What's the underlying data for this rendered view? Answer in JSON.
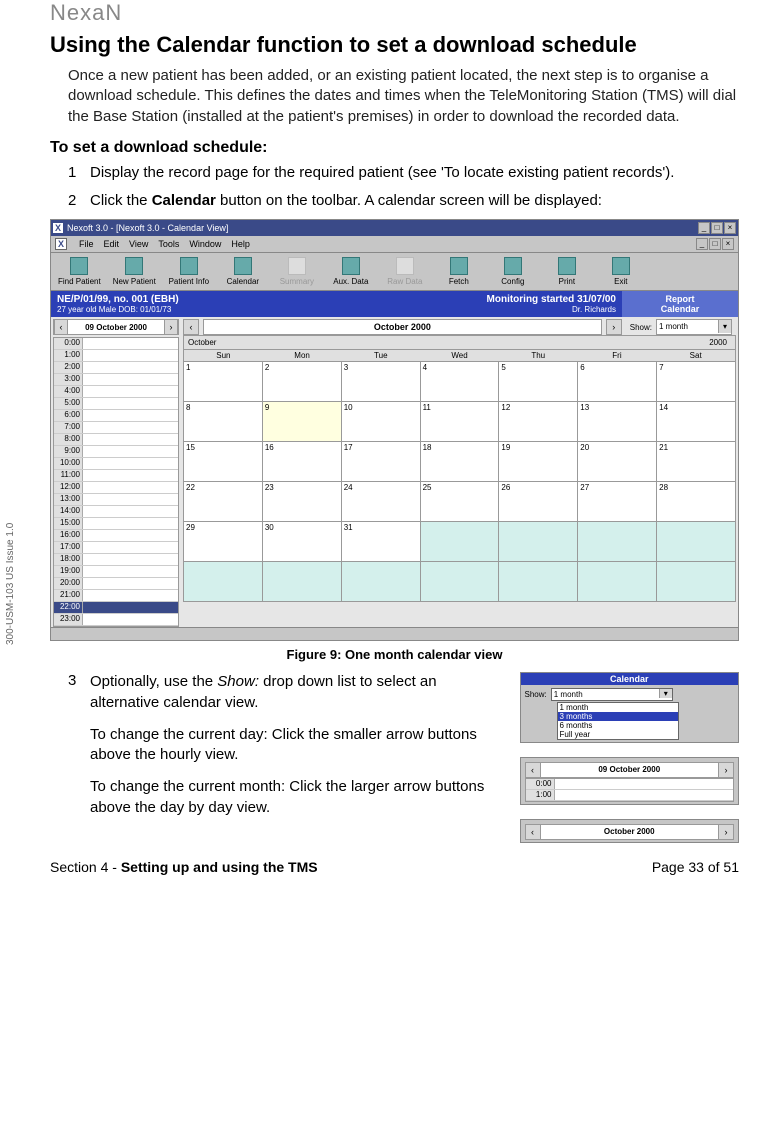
{
  "brand": "NexaN",
  "heading": "Using the Calendar function to set a download schedule",
  "intro_body": "Once a new patient has been added, or an existing patient located, the next step is to organise a download schedule. This defines the dates and times when the TeleMonitoring Station (TMS) will dial the Base Station (installed at the patient's premises) in order to download the recorded data.",
  "subheading": "To set a download schedule:",
  "step1_num": "1",
  "step1_body": "Display the record page for the required patient (see 'To locate existing patient records').",
  "step2_num": "2",
  "step2_pre": "Click the ",
  "step2_bold": "Calendar",
  "step2_post": " button on the toolbar. A calendar screen will be displayed:",
  "ss": {
    "outer_title": "Nexoft 3.0 - [Nexoft 3.0 - Calendar View]",
    "menu": {
      "file": "File",
      "edit": "Edit",
      "view": "View",
      "tools": "Tools",
      "window": "Window",
      "help": "Help"
    },
    "toolbar": {
      "find": "Find Patient",
      "new": "New Patient",
      "info": "Patient Info",
      "calendar": "Calendar",
      "summary": "Summary",
      "aux": "Aux. Data",
      "raw": "Raw Data",
      "fetch": "Fetch",
      "config": "Config",
      "print": "Print",
      "exit": "Exit"
    },
    "patient": {
      "title": "NE/P/01/99, no. 001 (EBH)",
      "sub": "27 year old Male  DOB: 01/01/73",
      "mon_started": "Monitoring started 31/07/00",
      "mon_sub": "Dr. Richards",
      "report": "Report",
      "calendar": "Calendar"
    },
    "date_nav_label": "09 October 2000",
    "hours": [
      "0:00",
      "1:00",
      "2:00",
      "3:00",
      "4:00",
      "5:00",
      "6:00",
      "7:00",
      "8:00",
      "9:00",
      "10:00",
      "11:00",
      "12:00",
      "13:00",
      "14:00",
      "15:00",
      "16:00",
      "17:00",
      "18:00",
      "19:00",
      "20:00",
      "21:00",
      "22:00",
      "23:00"
    ],
    "selected_hour_index": 22,
    "month_nav_label": "October 2000",
    "show_label": "Show:",
    "show_value": "1 month",
    "month_header_month": "October",
    "month_header_year": "2000",
    "dow": [
      "Sun",
      "Mon",
      "Tue",
      "Wed",
      "Thu",
      "Fri",
      "Sat"
    ],
    "cells": [
      "1",
      "2",
      "3",
      "4",
      "5",
      "6",
      "7",
      "8",
      "9",
      "10",
      "11",
      "12",
      "13",
      "14",
      "15",
      "16",
      "17",
      "18",
      "19",
      "20",
      "21",
      "22",
      "23",
      "24",
      "25",
      "26",
      "27",
      "28",
      "29",
      "30",
      "31",
      "",
      "",
      "",
      "",
      "",
      "",
      "",
      "",
      "",
      "",
      ""
    ],
    "today_index": 8,
    "next_start_index": 31
  },
  "figure_caption": "Figure 9: One month calendar view",
  "step3_num": "3",
  "step3_a1": "Optionally, use the ",
  "step3_a_italic": "Show:",
  "step3_a2": " drop down list to select an alternative calendar view.",
  "step3_b": "To change the current day: Click the smaller arrow buttons above the hourly view.",
  "step3_c": "To change the current month: Click the larger arrow buttons above the day by day view.",
  "mini": {
    "cal_header": "Calendar",
    "show_label": "Show:",
    "dropdown_sel": "1 month",
    "options": [
      "1 month",
      "3 months",
      "6 months",
      "Full year"
    ],
    "highlight_index": 1,
    "datebar_label": "09 October 2000",
    "monthbar_label": "October 2000",
    "mini_hours": [
      "0:00",
      "1:00"
    ]
  },
  "doc_code": "300-USM-103 US Issue 1.0",
  "footer_left_pre": "Section 4 - ",
  "footer_left_bold": "Setting up and using the TMS",
  "footer_right": "Page 33 of 51"
}
